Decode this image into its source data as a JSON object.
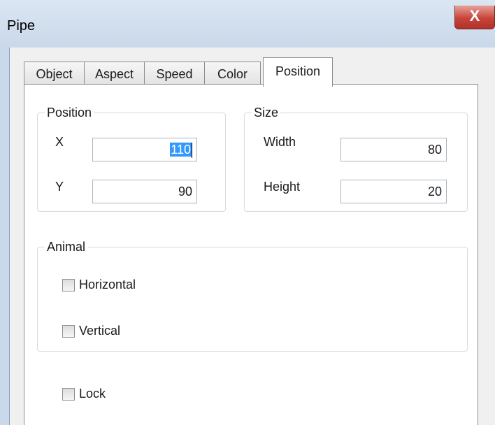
{
  "window": {
    "title": "Pipe",
    "close_glyph": "X"
  },
  "tabs": [
    {
      "label": "Object"
    },
    {
      "label": "Aspect"
    },
    {
      "label": "Speed"
    },
    {
      "label": "Color"
    },
    {
      "label": "Position",
      "active": true
    }
  ],
  "position": {
    "legend": "Position",
    "x_label": "X",
    "x_value": "110",
    "y_label": "Y",
    "y_value": "90"
  },
  "size": {
    "legend": "Size",
    "width_label": "Width",
    "width_value": "80",
    "height_label": "Height",
    "height_value": "20"
  },
  "animal": {
    "legend": "Animal",
    "horizontal_label": "Horizontal",
    "horizontal_checked": false,
    "vertical_label": "Vertical",
    "vertical_checked": false
  },
  "lock": {
    "label": "Lock",
    "checked": false
  },
  "colors": {
    "selection": "#3399ff",
    "close_button": "#c7443a"
  }
}
